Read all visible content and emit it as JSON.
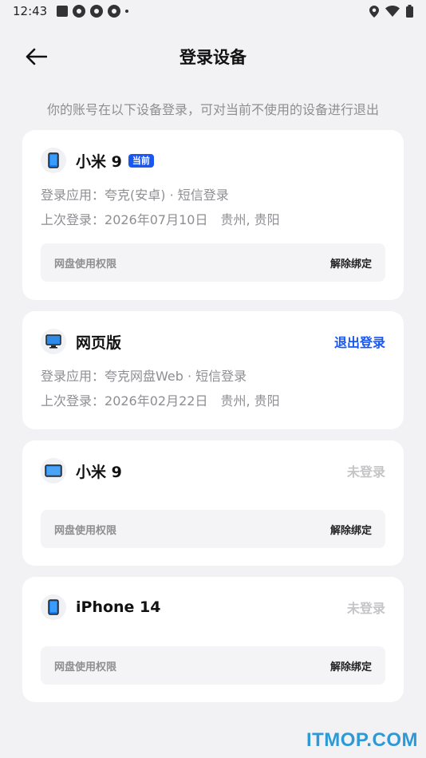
{
  "status_bar": {
    "time": "12:43"
  },
  "header": {
    "title": "登录设备"
  },
  "hint": "你的账号在以下设备登录，可对当前不使用的设备进行退出",
  "devices": [
    {
      "icon": "phone-icon",
      "name": "小米 9",
      "badge": "当前",
      "app_line": "登录应用：夸克(安卓) · 短信登录",
      "last_login_label": "上次登录：",
      "last_login_date": "2026年07月10日",
      "location": "贵州, 贵阳",
      "perm_label": "网盘使用权限",
      "perm_action": "解除绑定"
    },
    {
      "icon": "monitor-icon",
      "name": "网页版",
      "action": "退出登录",
      "app_line": "登录应用：夸克网盘Web · 短信登录",
      "last_login_label": "上次登录：",
      "last_login_date": "2026年02月22日",
      "location": "贵州, 贵阳"
    },
    {
      "icon": "tablet-icon",
      "name": "小米 9",
      "status": "未登录",
      "perm_label": "网盘使用权限",
      "perm_action": "解除绑定"
    },
    {
      "icon": "phone-icon",
      "name": "iPhone 14",
      "status": "未登录",
      "perm_label": "网盘使用权限",
      "perm_action": "解除绑定"
    }
  ],
  "watermark": "ITMOP.COM"
}
